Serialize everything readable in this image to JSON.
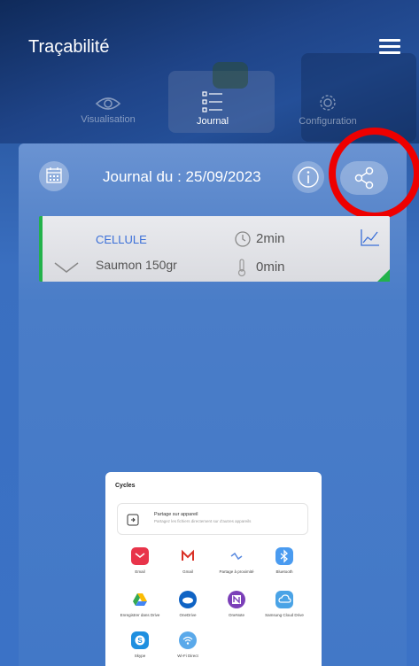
{
  "header": {
    "title": "Traçabilité",
    "tabs": [
      {
        "label": "Visualisation",
        "icon": "eye-icon",
        "active": false
      },
      {
        "label": "Journal",
        "icon": "list-icon",
        "active": true
      },
      {
        "label": "Configuration",
        "icon": "settings-icon",
        "active": false
      }
    ]
  },
  "journal": {
    "date_label": "Journal du : 25/09/2023"
  },
  "entry": {
    "cell": "CELLULE",
    "product": "Saumon 150gr",
    "time": "2min",
    "temperature_time": "0min",
    "status_color": "#23b24b"
  },
  "share_sheet": {
    "title": "Cycles",
    "nearby": {
      "title": "Partage sur appareil",
      "subtitle": "Partagez les fichiers directement sur d'autres appareils"
    },
    "apps": [
      {
        "label": "Email",
        "icon": "email-icon",
        "color": "#e8344a"
      },
      {
        "label": "Gmail",
        "icon": "gmail-icon",
        "color": "#ffffff"
      },
      {
        "label": "Partage à proximité",
        "icon": "nearby-share-icon",
        "color": "#ffffff"
      },
      {
        "label": "Bluetooth",
        "icon": "bluetooth-icon",
        "color": "#4a9bf0"
      },
      {
        "label": "Enregistrer dans Drive",
        "icon": "google-drive-icon",
        "color": "#ffffff"
      },
      {
        "label": "OneDrive",
        "icon": "onedrive-icon",
        "color": "#0f63c4"
      },
      {
        "label": "OneNote",
        "icon": "onenote-icon",
        "color": "#7b3fb8"
      },
      {
        "label": "Samsung Cloud Drive",
        "icon": "samsung-cloud-icon",
        "color": "#4aa3e6"
      },
      {
        "label": "Skype",
        "icon": "skype-icon",
        "color": "#1e8fe0"
      },
      {
        "label": "Wi-Fi Direct",
        "icon": "wifi-direct-icon",
        "color": "#5aa9ea"
      }
    ]
  },
  "accent": "#3b6fd8",
  "highlight_color": "#e00000"
}
